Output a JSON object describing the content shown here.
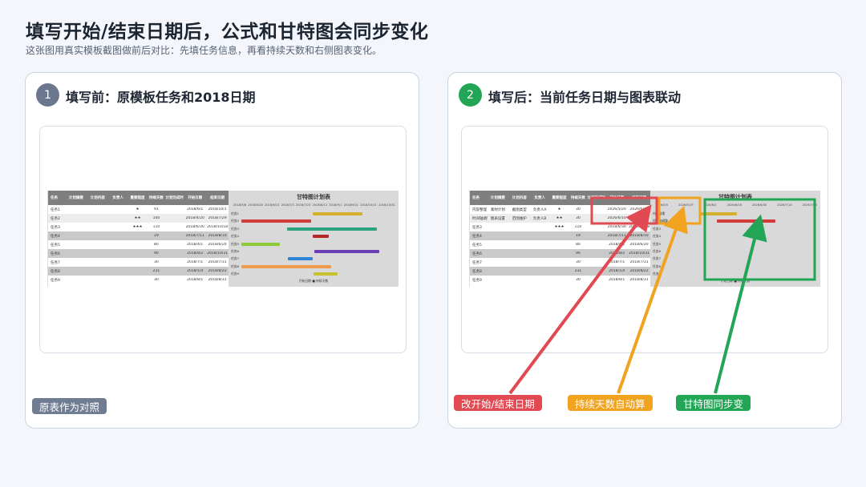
{
  "header": {
    "title": "填写开始/结束日期后，公式和甘特图会同步变化",
    "subtitle": "这张图用真实模板截图做前后对比：先填任务信息，再看持续天数和右侧图表变化。"
  },
  "colors": {
    "before_badge": "#6b778e",
    "after_badge": "#23a556",
    "red": "#e14a52",
    "orange": "#f1a21e",
    "green": "#23a556"
  },
  "before": {
    "number": "1",
    "title": "填写前：原模板任务和2018日期",
    "tag": "原表作为对照",
    "sheet": {
      "columns": [
        "任务",
        "计划摘要",
        "计划内容",
        "负责人",
        "重要程度",
        "持续天数",
        "计划完成时间",
        "开始日期",
        "结束日期"
      ],
      "rows": [
        [
          "任务1",
          "",
          "",
          "",
          "★",
          "91",
          "",
          "2018/6/1",
          "2018/10/1"
        ],
        [
          "任务2",
          "",
          "",
          "",
          "★★",
          "100",
          "",
          "2018/4/20",
          "2018/7/29"
        ],
        [
          "任务3",
          "",
          "",
          "",
          "★★★",
          "110",
          "",
          "2018/6/30",
          "2018/10/18"
        ],
        [
          "任务4",
          "",
          "",
          "",
          "",
          "19",
          "",
          "2018/7/11",
          "2018/8/10"
        ],
        [
          "任务5",
          "",
          "",
          "",
          "",
          "80",
          "",
          "2018/4/1",
          "2018/6/20"
        ],
        [
          "任务6",
          "",
          "",
          "",
          "",
          "90",
          "",
          "2018/8/2",
          "2018/10/31"
        ],
        [
          "任务7",
          "",
          "",
          "",
          "",
          "30",
          "",
          "2018/7/1",
          "2018/7/31"
        ],
        [
          "任务8",
          "",
          "",
          "",
          "",
          "231",
          "",
          "2018/1/4",
          "2018/8/22"
        ],
        [
          "任务9",
          "",
          "",
          "",
          "",
          "30",
          "",
          "2018/8/1",
          "2018/8/31"
        ]
      ],
      "gantt_title": "甘特图计划表",
      "gantt_dates": [
        "2018/5/8",
        "2018/5/28",
        "2018/6/13",
        "2018/7/3",
        "2018/7/23",
        "2018/8/12",
        "2018/9/1",
        "2018/9/21",
        "2018/10/11",
        "2018/10/31"
      ],
      "gantt_tasks": [
        "任务1",
        "任务2",
        "任务3",
        "任务4",
        "任务5",
        "任务6",
        "任务7",
        "任务8",
        "任务9"
      ],
      "gantt_legend": "开始日期 ■ 持续天数"
    }
  },
  "after": {
    "number": "2",
    "title": "填写后：当前任务日期与图表联动",
    "tags": {
      "red": "改开始/结束日期",
      "orange": "持续天数自动算",
      "green": "甘特图同步变"
    },
    "sheet": {
      "columns": [
        "任务",
        "计划摘要",
        "计划内容",
        "负责人",
        "重要程度",
        "持续天数",
        "计划完成时间",
        "开始日期",
        "结束日期"
      ],
      "rows": [
        [
          "内容整理",
          "素材计划",
          "截图类型",
          "负责人A",
          "★",
          "30",
          "",
          "2026/5/20",
          "2026/6/19"
        ],
        [
          "时间轴调整",
          "图表设置",
          "范围维护",
          "负责人B",
          "★★",
          "30",
          "",
          "2026/6/10",
          "2026/7/10"
        ],
        [
          "任务3",
          "",
          "",
          "",
          "★★★",
          "110",
          "",
          "2018/6/30",
          "2018/10/18"
        ],
        [
          "任务4",
          "",
          "",
          "",
          "",
          "19",
          "",
          "2018/7/11",
          "2018/8/10"
        ],
        [
          "任务5",
          "",
          "",
          "",
          "",
          "80",
          "",
          "2018/4/1",
          "2018/6/20"
        ],
        [
          "任务6",
          "",
          "",
          "",
          "",
          "90",
          "",
          "2018/8/2",
          "2018/10/31"
        ],
        [
          "任务7",
          "",
          "",
          "",
          "",
          "30",
          "",
          "2018/7/1",
          "2018/7/31"
        ],
        [
          "任务8",
          "",
          "",
          "",
          "",
          "231",
          "",
          "2018/1/4",
          "2018/8/22"
        ],
        [
          "任务9",
          "",
          "",
          "",
          "",
          "30",
          "",
          "2018/8/1",
          "2018/8/31"
        ]
      ],
      "gantt_title": "甘特图计划表",
      "gantt_dates": [
        "2026/5/5",
        "2026/5/19",
        "2026/6/2",
        "2026/6/16",
        "2026/6/30",
        "2026/7/14",
        "2026/7/28"
      ],
      "gantt_tasks": [
        "内容整理",
        "时间轴调整",
        "任务3",
        "任务4",
        "任务5",
        "任务6",
        "任务7",
        "任务8",
        "任务9"
      ],
      "gantt_legend": "开始日期 ■ 持续天数"
    }
  }
}
